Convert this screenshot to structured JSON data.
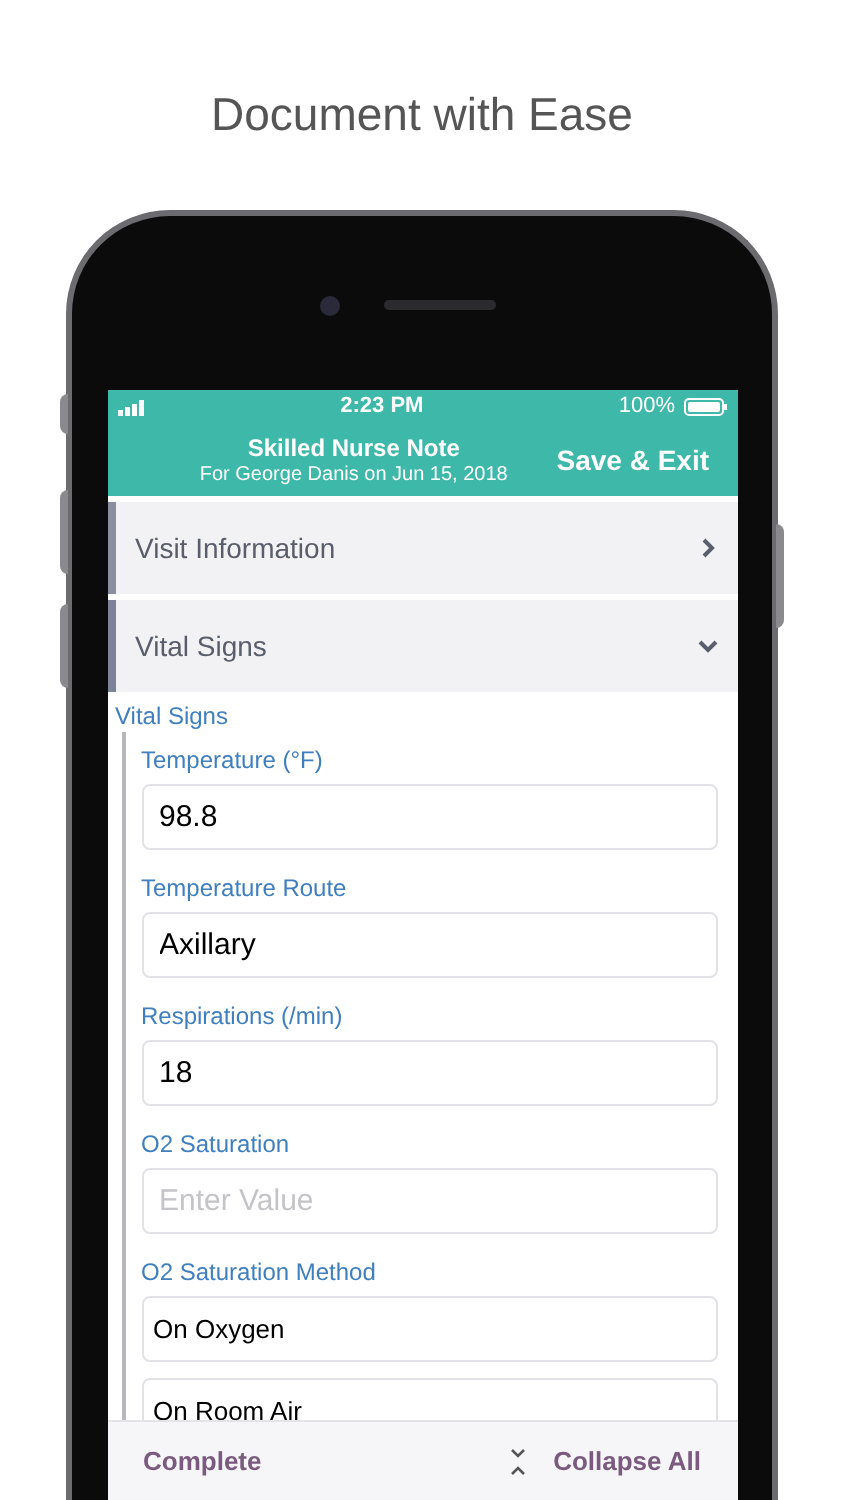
{
  "headline": "Document with Ease",
  "status_bar": {
    "time": "2:23 PM",
    "battery": "100%"
  },
  "header": {
    "title": "Skilled Nurse Note",
    "subtitle": "For George Danis on Jun 15, 2018",
    "action": "Save & Exit"
  },
  "sections": [
    {
      "title": "Visit Information",
      "expanded": false
    },
    {
      "title": "Vital Signs",
      "expanded": true
    }
  ],
  "group_label": "Vital Signs",
  "fields": [
    {
      "kind": "input",
      "label": "Temperature (°F)",
      "value": "98.8"
    },
    {
      "kind": "input",
      "label": "Temperature Route",
      "value": "Axillary"
    },
    {
      "kind": "input",
      "label": "Respirations (/min)",
      "value": "18"
    },
    {
      "kind": "input",
      "label": "O2 Saturation",
      "placeholder": "Enter Value"
    },
    {
      "kind": "options",
      "label": "O2 Saturation Method",
      "options": [
        "On Oxygen",
        "On Room Air"
      ]
    }
  ],
  "footer": {
    "complete": "Complete",
    "collapse": "Collapse All"
  }
}
